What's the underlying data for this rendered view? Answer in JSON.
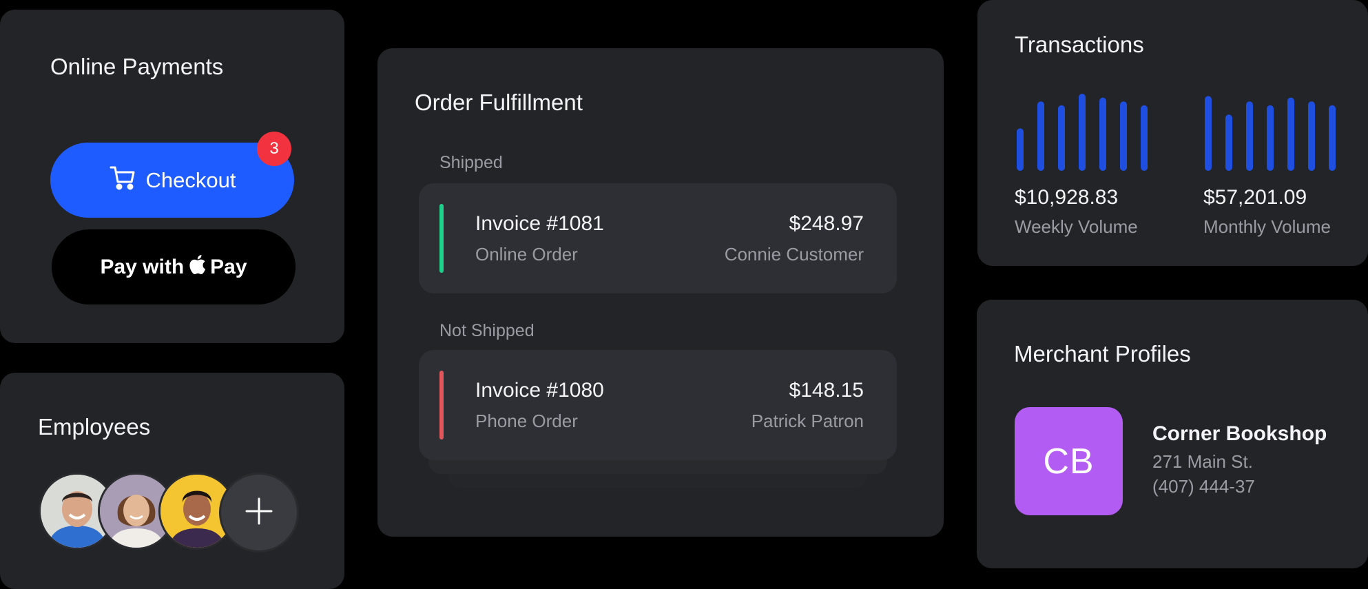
{
  "payments": {
    "title": "Online Payments",
    "checkout_label": "Checkout",
    "checkout_badge": "3",
    "applepay_prefix": "Pay with",
    "applepay_suffix": "Pay"
  },
  "employees": {
    "title": "Employees",
    "add_icon": "plus-icon"
  },
  "orders": {
    "title": "Order Fulfillment",
    "groups": [
      {
        "label": "Shipped",
        "status_color": "#1fd08a",
        "invoice": "Invoice #1081",
        "order_type": "Online Order",
        "amount": "$248.97",
        "customer": "Connie Customer"
      },
      {
        "label": "Not Shipped",
        "status_color": "#e0575b",
        "invoice": "Invoice #1080",
        "order_type": "Phone Order",
        "amount": "$148.15",
        "customer": "Patrick Patron"
      }
    ]
  },
  "transactions": {
    "title": "Transactions",
    "bar_color": "#1f4fe0",
    "weekly": {
      "value": "$10,928.83",
      "label": "Weekly Volume",
      "bars": [
        0.55,
        0.9,
        0.85,
        1.0,
        0.95,
        0.9,
        0.85
      ]
    },
    "monthly": {
      "value": "$57,201.09",
      "label": "Monthly Volume",
      "bars": [
        0.97,
        0.73,
        0.9,
        0.85,
        0.95,
        0.9,
        0.85
      ]
    }
  },
  "merchant": {
    "title": "Merchant Profiles",
    "initials": "CB",
    "avatar_color": "#b35cf4",
    "name": "Corner Bookshop",
    "address": "271 Main St.",
    "phone": "(407) 444-37"
  }
}
